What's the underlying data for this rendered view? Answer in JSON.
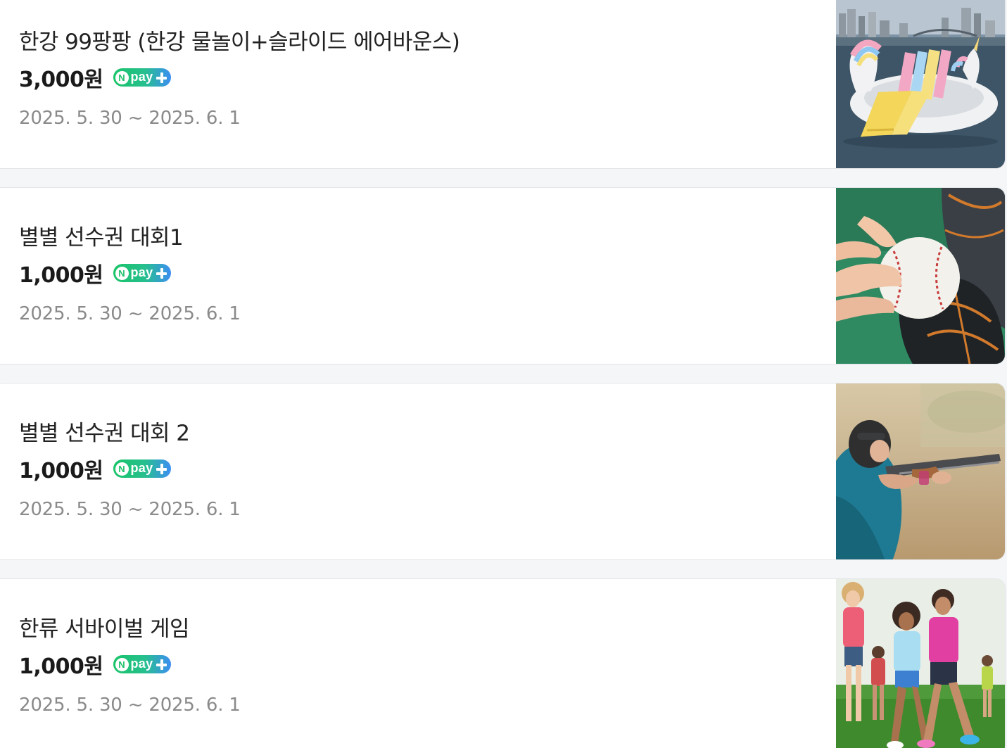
{
  "programs": [
    {
      "title": "한강 99팡팡 (한강 물놀이+슬라이드 에어바운스)",
      "price": "3,000원",
      "dates": "2025. 5. 30 ~ 2025. 6. 1",
      "image": "inflatable-unicorn-slide-on-river-image"
    },
    {
      "title": "별별 선수권 대회1",
      "price": "1,000원",
      "dates": "2025. 5. 30 ~ 2025. 6. 1",
      "image": "hand-holding-baseball-with-glove-image"
    },
    {
      "title": "별별 선수권 대회 2",
      "price": "1,000원",
      "dates": "2025. 5. 30 ~ 2025. 6. 1",
      "image": "child-aiming-shotgun-image"
    },
    {
      "title": "한류 서바이벌 게임",
      "price": "1,000원",
      "dates": "2025. 5. 30 ~ 2025. 6. 1",
      "image": "children-running-on-grass-image"
    }
  ],
  "badge": {
    "n_letter": "N",
    "pay_word": "pay"
  },
  "colors": {
    "page_background": "#f5f6f8",
    "card_background": "#ffffff",
    "title_text": "#222222",
    "date_text": "#8a8a8a",
    "npay_green": "#19c468",
    "npay_blue": "#3d8ef3"
  }
}
